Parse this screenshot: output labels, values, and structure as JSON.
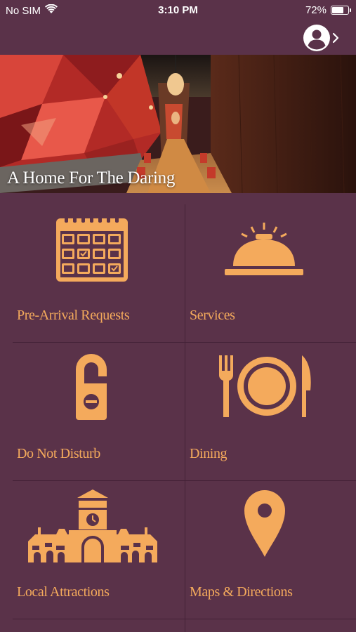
{
  "status_bar": {
    "carrier": "No SIM",
    "time": "3:10 PM",
    "battery_percent": "72%",
    "battery_level": 0.72,
    "wifi_icon": "wifi-icon"
  },
  "header": {
    "profile_icon": "user-circle-icon",
    "chevron_icon": "chevron-right-icon"
  },
  "hero": {
    "title": "A Home For The Daring"
  },
  "colors": {
    "background": "#5a3249",
    "accent": "#f4aa5c",
    "text": "#ffffff"
  },
  "tiles": [
    {
      "label": "Pre-Arrival Requests",
      "icon": "calendar-icon"
    },
    {
      "label": "Services",
      "icon": "service-bell-icon"
    },
    {
      "label": "Do Not Disturb",
      "icon": "door-hanger-icon"
    },
    {
      "label": "Dining",
      "icon": "fork-plate-knife-icon"
    },
    {
      "label": "Local Attractions",
      "icon": "building-clock-tower-icon"
    },
    {
      "label": "Maps & Directions",
      "icon": "map-pin-icon"
    }
  ]
}
